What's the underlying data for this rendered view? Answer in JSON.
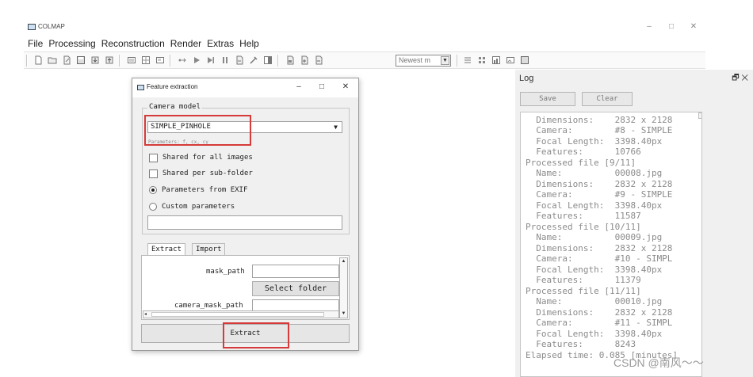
{
  "app": {
    "title": "COLMAP"
  },
  "window_controls": {
    "minimize": "–",
    "maximize": "□",
    "close": "✕"
  },
  "menubar": [
    "File",
    "Processing",
    "Reconstruction",
    "Render",
    "Extras",
    "Help"
  ],
  "toolbar": {
    "icons": [
      "new-project-icon",
      "open-project-icon",
      "edit-project-icon",
      "save-project-icon",
      "import-icon",
      "export-icon",
      "feature-extraction-icon",
      "feature-matching-icon",
      "database-icon",
      "automatic-reconstruction-icon",
      "start-reconstruction-icon",
      "step-reconstruction-icon",
      "pause-reconstruction-icon",
      "reset-reconstruction-icon",
      "bundle-adjustment-icon",
      "dense-reconstruction-icon",
      "render-options-icon",
      "zoom-in-icon",
      "zoom-out-icon",
      "grab-image-icon",
      "match-matrix-icon",
      "log-icon",
      "reconstruction-stats-icon",
      "model-viewer-icon",
      "match-icon"
    ],
    "model_combo": "Newest m"
  },
  "dialog": {
    "title": "Feature extraction",
    "controls": {
      "minimize": "–",
      "maximize": "□",
      "close": "✕"
    },
    "camera_group": "Camera model",
    "camera_model": "SIMPLE_PINHOLE",
    "params_hint": "Parameters: f, cx, cy",
    "options": {
      "shared_all": "Shared for all images",
      "shared_sub": "Shared per sub-folder",
      "params_exif": "Parameters from EXIF",
      "custom_params": "Custom parameters"
    },
    "tabs": [
      "Extract",
      "Import"
    ],
    "mask_path_label": "mask_path",
    "select_folder": "Select folder",
    "camera_mask_label": "camera_mask_path",
    "extract_button": "Extract"
  },
  "log": {
    "title": "Log",
    "tools": "🗗 ✕",
    "save": "Save",
    "clear": "Clear",
    "lines": [
      "  Dimensions:    2832 x 2128",
      "  Camera:        #8 - SIMPLE",
      "  Focal Length:  3398.40px",
      "  Features:      10766",
      "Processed file [9/11]",
      "  Name:          00008.jpg",
      "  Dimensions:    2832 x 2128",
      "  Camera:        #9 - SIMPLE",
      "  Focal Length:  3398.40px",
      "  Features:      11587",
      "Processed file [10/11]",
      "  Name:          00009.jpg",
      "  Dimensions:    2832 x 2128",
      "  Camera:        #10 - SIMPL",
      "  Focal Length:  3398.40px",
      "  Features:      11379",
      "Processed file [11/11]",
      "  Name:          00010.jpg",
      "  Dimensions:    2832 x 2128",
      "  Camera:        #11 - SIMPL",
      "  Focal Length:  3398.40px",
      "  Features:      8243",
      "Elapsed time: 0.085 [minutes]"
    ]
  },
  "watermark": "CSDN @南风～～",
  "colors": {
    "highlight": "#d63a3a",
    "log_text": "#8b8b8b"
  }
}
